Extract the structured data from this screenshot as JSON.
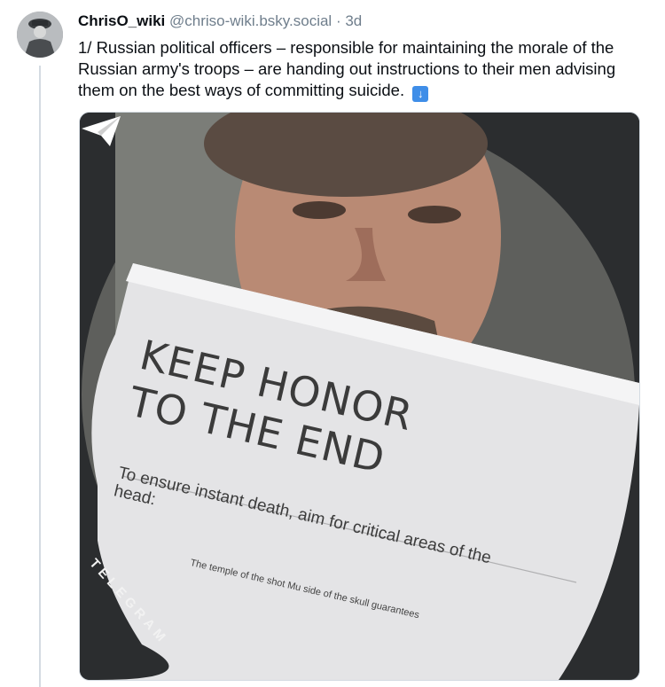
{
  "post": {
    "author": "ChrisO_wiki",
    "handle": "@chriso-wiki.bsky.social",
    "separator": "·",
    "time": "3d",
    "text": "1/ Russian political officers – responsible for maintaining the morale of the Russian army's troops – are handing out instructions to their men advising them on the best ways of committing suicide.",
    "emoji": "⬇️"
  },
  "image": {
    "headline_line1": "KEEP HONOR",
    "headline_line2": "TO THE END",
    "instruction_line1": "To ensure instant death, aim for critical areas of the",
    "instruction_line2": "head:",
    "small_text": "The temple of the shot Mu side of the skull guarantees",
    "watermark": "TELEGRAM"
  },
  "colors": {
    "accent": "#3f8ee8",
    "muted_text": "#6f7e8c",
    "thread_line": "#d4dbe2"
  }
}
